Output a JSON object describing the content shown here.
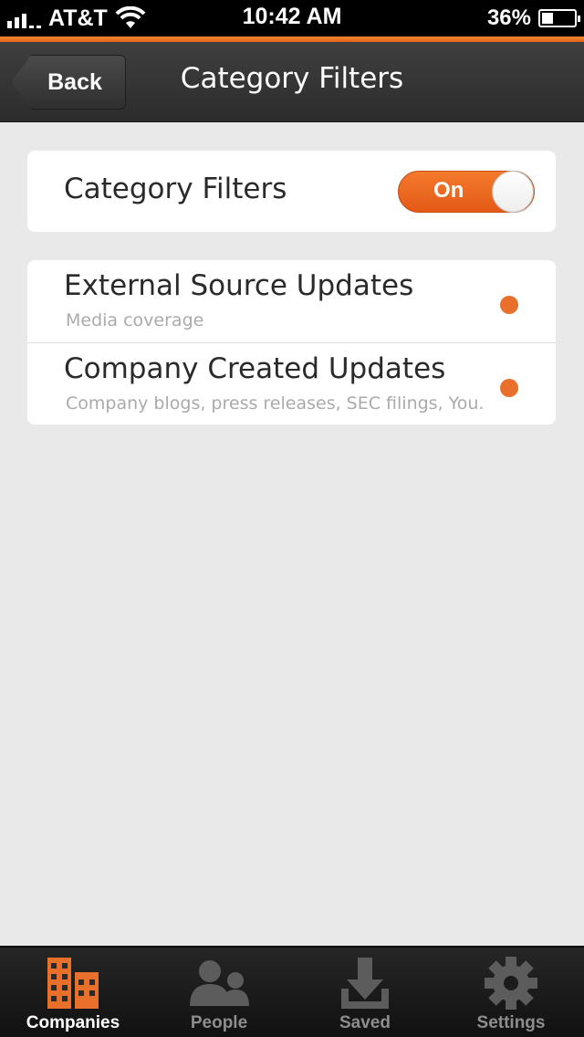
{
  "status_bar": {
    "carrier": "AT&T",
    "time": "10:42 AM",
    "battery_percent": "36%",
    "battery_level": 0.36
  },
  "nav": {
    "back_label": "Back",
    "title": "Category Filters"
  },
  "filter_toggle": {
    "label": "Category Filters",
    "state_label": "On",
    "on": true
  },
  "categories": [
    {
      "title": "External Source Updates",
      "subtitle": "Media coverage",
      "dot_color": "#e8702a"
    },
    {
      "title": "Company Created Updates",
      "subtitle": "Company blogs, press releases, SEC filings, You...",
      "dot_color": "#e8702a"
    }
  ],
  "tabs": [
    {
      "label": "Companies",
      "icon": "buildings-icon",
      "active": true
    },
    {
      "label": "People",
      "icon": "people-icon",
      "active": false
    },
    {
      "label": "Saved",
      "icon": "download-tray-icon",
      "active": false
    },
    {
      "label": "Settings",
      "icon": "gear-icon",
      "active": false
    }
  ],
  "colors": {
    "accent": "#e8702a",
    "background": "#e9e9e9",
    "nav_bar": "#333333"
  }
}
